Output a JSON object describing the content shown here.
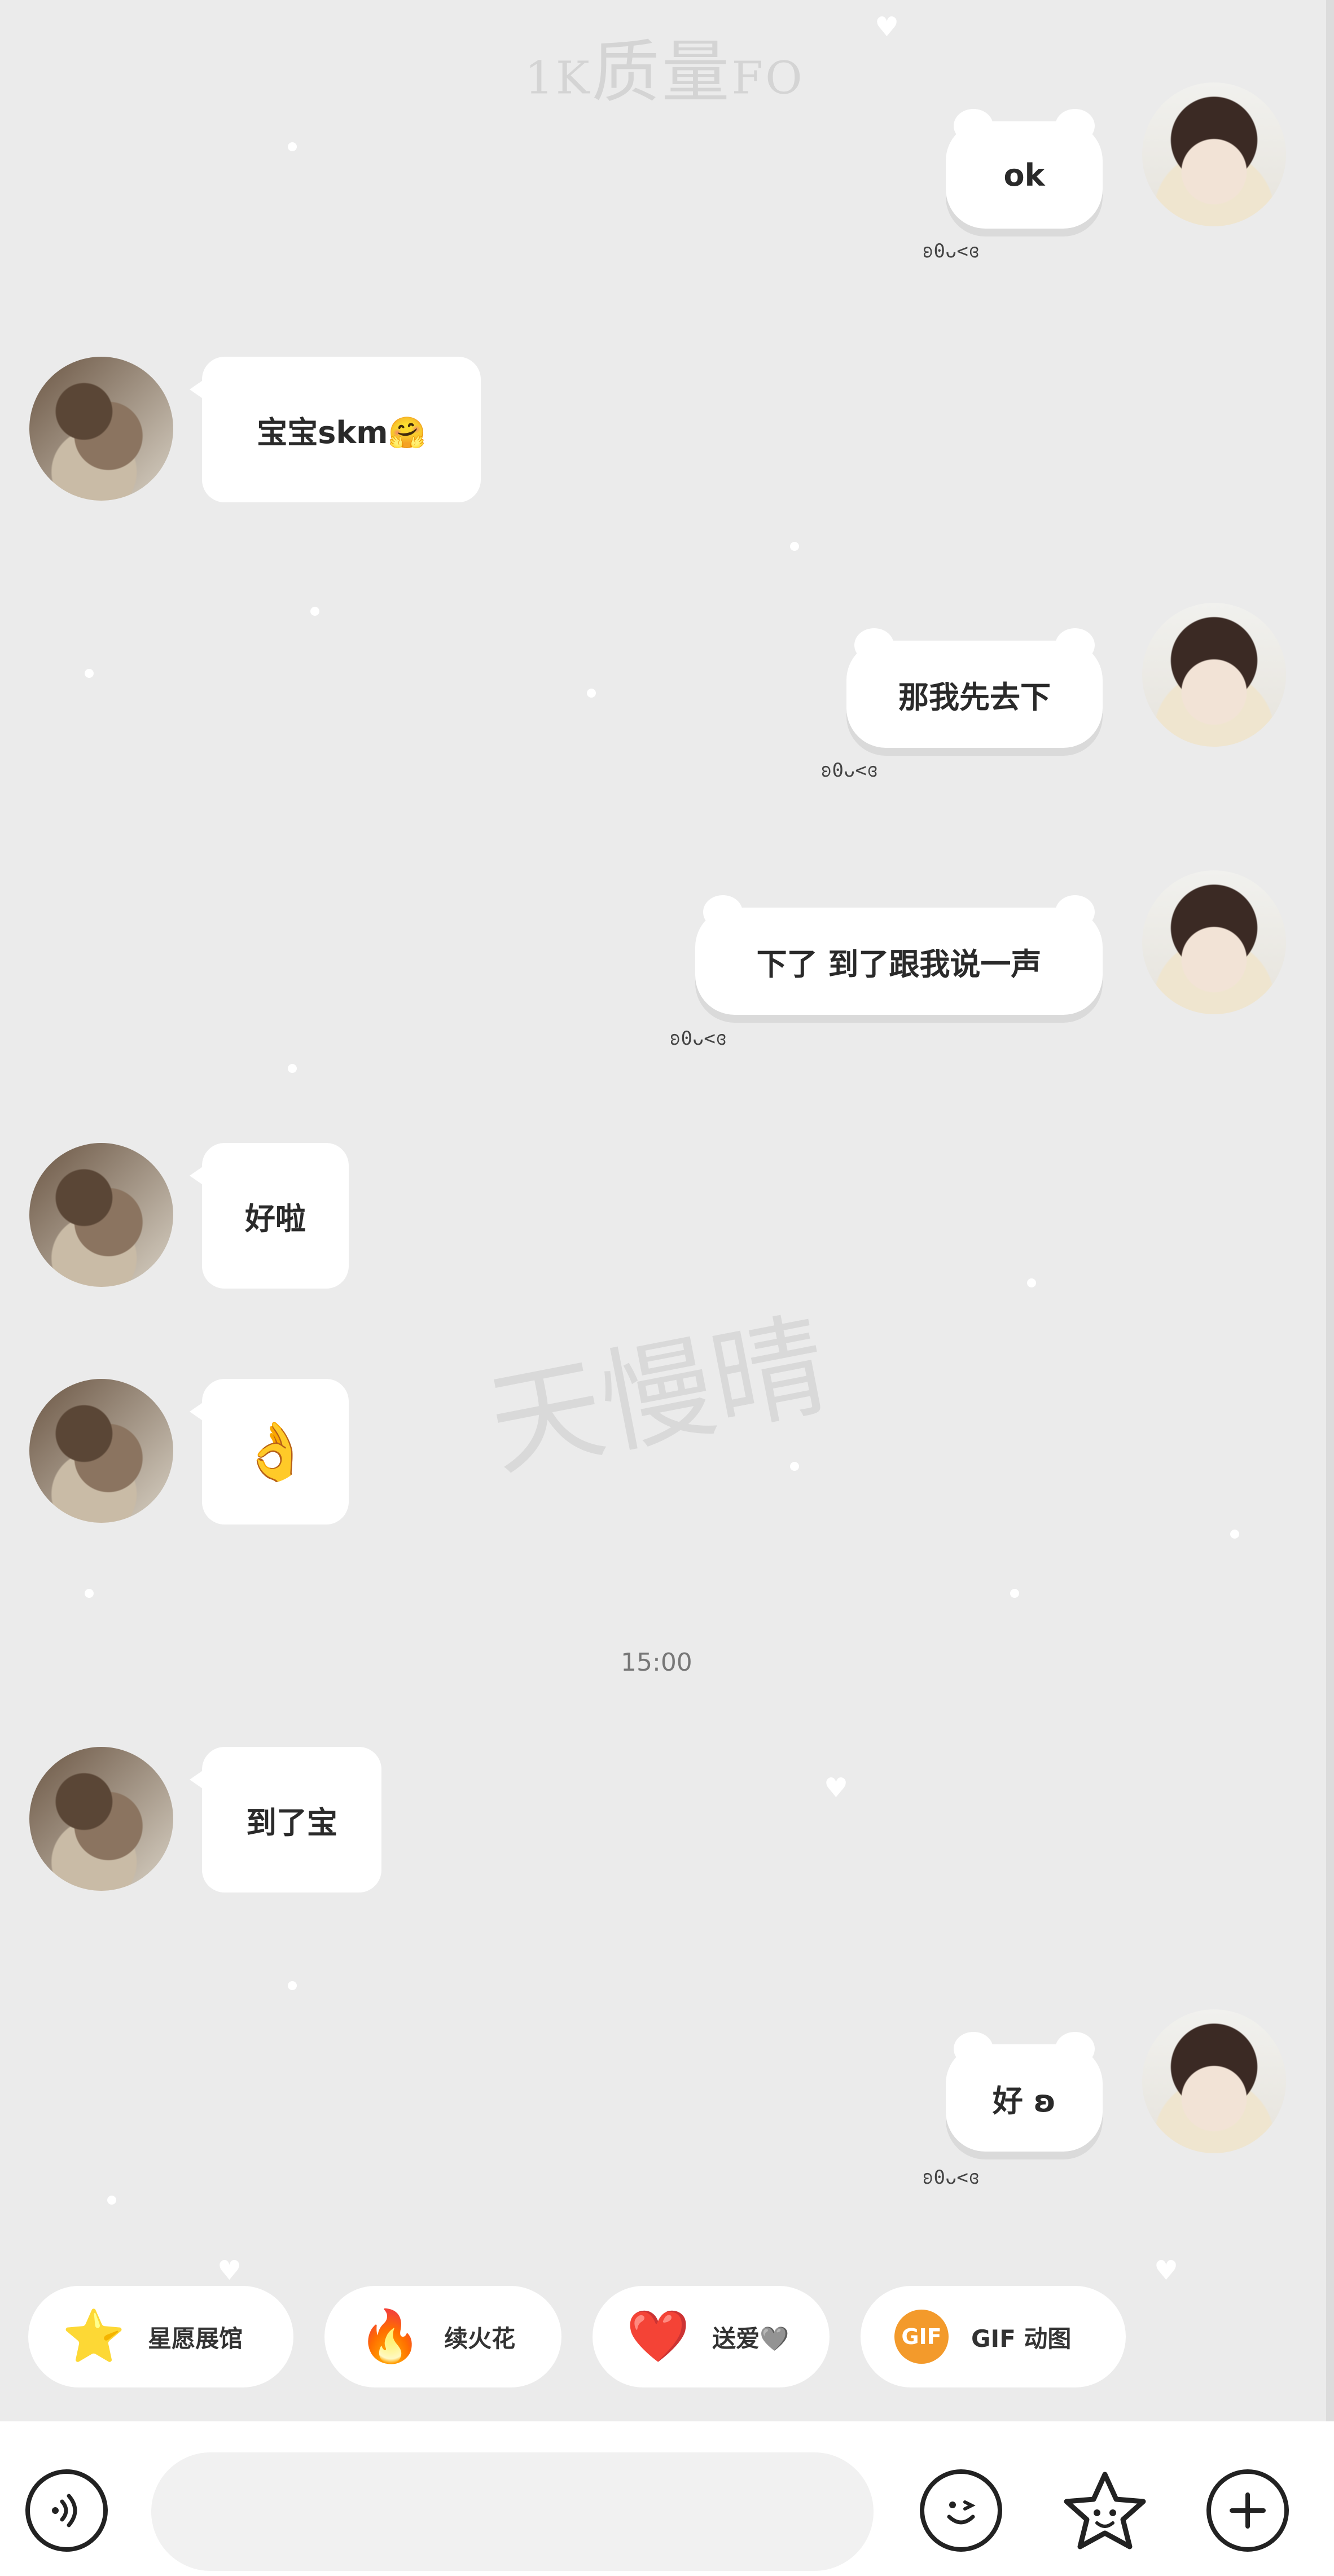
{
  "watermarks": {
    "top_small_left": "1K",
    "top_main": "质量",
    "top_small_right": "FO",
    "center": "天慢晴"
  },
  "messages": [
    {
      "side": "right",
      "text": "ok",
      "suffix": "ʚ0ᴗ<ɞ"
    },
    {
      "side": "left",
      "text": "宝宝skm🤗"
    },
    {
      "side": "right",
      "text": "那我先去下",
      "suffix": "ʚ0ᴗ<ɞ"
    },
    {
      "side": "right",
      "text": "下了 到了跟我说一声",
      "suffix": "ʚ0ᴗ<ɞ"
    },
    {
      "side": "left",
      "text": "好啦"
    },
    {
      "side": "left",
      "text": "👌"
    },
    {
      "side": "left",
      "text": "到了宝"
    },
    {
      "side": "right",
      "text": "好 ʚ",
      "suffix": "ʚ0ᴗ<ɞ"
    }
  ],
  "timestamp": "15:00",
  "quick_actions": [
    {
      "label": "星愿展馆",
      "icon": "⭐"
    },
    {
      "label": "续火花",
      "icon": "🔥"
    },
    {
      "label": "送爱🩶",
      "icon": "❤️"
    },
    {
      "label": "GIF 动图",
      "icon": "GIF"
    }
  ],
  "input": {
    "placeholder": ""
  },
  "icons": {
    "voice": "voice-icon",
    "emoji": "emoji-icon",
    "sticker": "sticker-icon",
    "plus": "plus-icon"
  },
  "colors": {
    "background": "#ebebeb",
    "bubble": "#ffffff",
    "gif_badge": "#f39a2b"
  }
}
